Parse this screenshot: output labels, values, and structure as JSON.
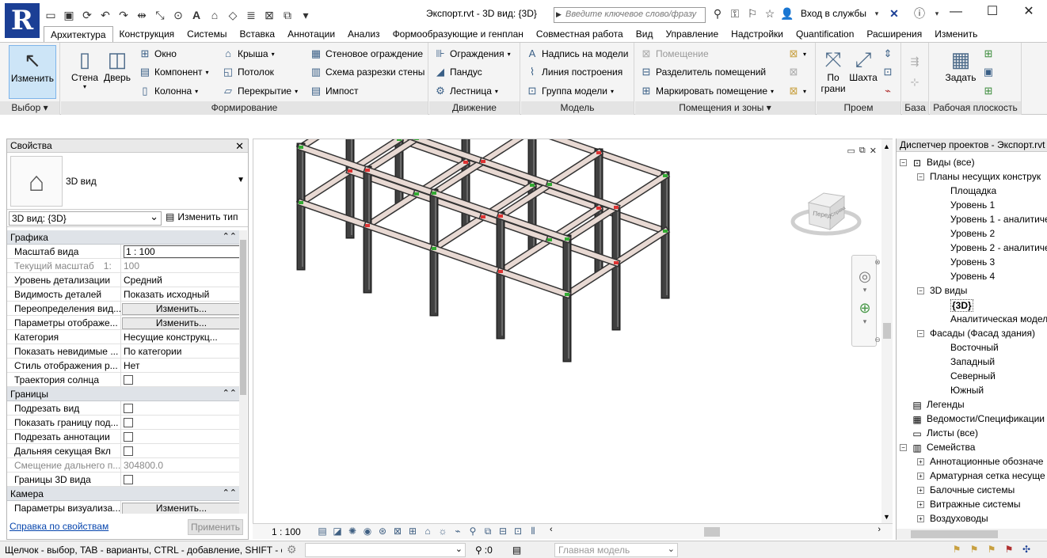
{
  "app": {
    "logo_letter": "R",
    "document_title": "Экспорт.rvt - 3D вид: {3D}",
    "search_placeholder": "Введите ключевое слово/фразу",
    "signin_label": "Вход в службы",
    "window_controls": [
      "—",
      "☐",
      "✕"
    ],
    "qat_icons": [
      "open-icon",
      "save-icon",
      "sync-icon",
      "undo-icon",
      "redo-icon",
      "measure-icon",
      "dimension-icon",
      "tag-icon",
      "text-icon",
      "3d-view-icon",
      "section-icon",
      "thin-lines-icon",
      "close-windows-icon",
      "switch-windows-icon",
      "customize-icon"
    ]
  },
  "ribbon_tabs": [
    {
      "label": "Архитектура",
      "active": true
    },
    {
      "label": "Конструкция"
    },
    {
      "label": "Системы"
    },
    {
      "label": "Вставка"
    },
    {
      "label": "Аннотации"
    },
    {
      "label": "Анализ"
    },
    {
      "label": "Формообразующие и генплан"
    },
    {
      "label": "Совместная работа"
    },
    {
      "label": "Вид"
    },
    {
      "label": "Управление"
    },
    {
      "label": "Надстройки"
    },
    {
      "label": "Quantification"
    },
    {
      "label": "Расширения"
    },
    {
      "label": "Изменить"
    }
  ],
  "ribbon": {
    "select": {
      "modify": "Изменить",
      "label": "Выбор ▾"
    },
    "build": {
      "wall": "Стена",
      "door": "Дверь",
      "window": "Окно",
      "component": "Компонент",
      "column": "Колонна",
      "roof": "Крыша",
      "ceiling": "Потолок",
      "floor": "Перекрытие",
      "curtain_system": "Стеновое ограждение",
      "curtain_grid": "Схема разрезки стены",
      "mullion": "Импост",
      "label": "Формирование"
    },
    "circulation": {
      "railing": "Ограждения",
      "ramp": "Пандус",
      "stair": "Лестница",
      "label": "Движение"
    },
    "model": {
      "model_text": "Надпись на модели",
      "model_line": "Линия построения",
      "model_group": "Группа модели",
      "label": "Модель"
    },
    "room": {
      "room": "Помещение",
      "room_separator": "Разделитель помещений",
      "tag_room": "Маркировать помещение",
      "label": "Помещения и зоны ▾"
    },
    "opening": {
      "by_face": "По",
      "by_face2": "грани",
      "shaft": "Шахта",
      "label": "Проем"
    },
    "datum": {
      "label": "База"
    },
    "workplane": {
      "set": "Задать",
      "label": "Рабочая плоскость"
    }
  },
  "properties": {
    "title": "Свойства",
    "type_name": "3D вид",
    "instance": "3D вид: {3D}",
    "edit_type": "Изменить тип",
    "groups": [
      {
        "name": "Графика",
        "rows": [
          {
            "name": "Масштаб вида",
            "value": "1 : 100",
            "kind": "scale"
          },
          {
            "name": "Текущий масштаб",
            "value": "100",
            "kind": "ro",
            "name_suffix": "1:"
          },
          {
            "name": "Уровень детализации",
            "value": "Средний"
          },
          {
            "name": "Видимость деталей",
            "value": "Показать исходный"
          },
          {
            "name": "Переопределения вид...",
            "value": "Изменить...",
            "kind": "button"
          },
          {
            "name": "Параметры отображе...",
            "value": "Изменить...",
            "kind": "button"
          },
          {
            "name": "Категория",
            "value": "Несущие конструкц..."
          },
          {
            "name": "Показать невидимые ...",
            "value": "По категории"
          },
          {
            "name": "Стиль отображения р...",
            "value": "Нет"
          },
          {
            "name": "Траектория солнца",
            "value": "",
            "kind": "check"
          }
        ]
      },
      {
        "name": "Границы",
        "rows": [
          {
            "name": "Подрезать вид",
            "value": "",
            "kind": "check"
          },
          {
            "name": "Показать границу под...",
            "value": "",
            "kind": "check"
          },
          {
            "name": "Подрезать аннотации",
            "value": "",
            "kind": "check"
          },
          {
            "name": "Дальняя секущая Вкл",
            "value": "",
            "kind": "check"
          },
          {
            "name": "Смещение дальнего п...",
            "value": "304800.0",
            "kind": "ro"
          },
          {
            "name": "Границы 3D вида",
            "value": "",
            "kind": "check"
          }
        ]
      },
      {
        "name": "Камера",
        "rows": [
          {
            "name": "Параметры визуализа...",
            "value": "Изменить...",
            "kind": "button"
          }
        ]
      }
    ],
    "help_link": "Справка по свойствам",
    "apply": "Применить"
  },
  "viewport": {
    "viewcube_face": "Перед",
    "viewcube_side": "Справа",
    "view_scale": "1 : 100"
  },
  "browser": {
    "title": "Диспетчер проектов - Экспорт.rvt",
    "nodes": [
      {
        "label": "Виды (все)",
        "level": 0,
        "toggle": "−",
        "icon": "views-icon"
      },
      {
        "label": "Планы несущих конструк",
        "level": 1,
        "toggle": "−"
      },
      {
        "label": "Площадка",
        "level": 2
      },
      {
        "label": "Уровень 1",
        "level": 2
      },
      {
        "label": "Уровень 1 - аналитиче",
        "level": 2
      },
      {
        "label": "Уровень 2",
        "level": 2
      },
      {
        "label": "Уровень 2 - аналитиче",
        "level": 2
      },
      {
        "label": "Уровень 3",
        "level": 2
      },
      {
        "label": "Уровень 4",
        "level": 2
      },
      {
        "label": "3D виды",
        "level": 1,
        "toggle": "−"
      },
      {
        "label": "{3D}",
        "level": 2,
        "bold": true
      },
      {
        "label": "Аналитическая модел",
        "level": 2
      },
      {
        "label": "Фасады (Фасад здания)",
        "level": 1,
        "toggle": "−"
      },
      {
        "label": "Восточный",
        "level": 2
      },
      {
        "label": "Западный",
        "level": 2
      },
      {
        "label": "Северный",
        "level": 2
      },
      {
        "label": "Южный",
        "level": 2
      },
      {
        "label": "Легенды",
        "level": 0,
        "icon": "legend-icon"
      },
      {
        "label": "Ведомости/Спецификации",
        "level": 0,
        "icon": "schedule-icon"
      },
      {
        "label": "Листы (все)",
        "level": 0,
        "icon": "sheet-icon"
      },
      {
        "label": "Семейства",
        "level": 0,
        "toggle": "−",
        "icon": "family-icon"
      },
      {
        "label": "Аннотационные обозначе",
        "level": 1,
        "toggle": "+"
      },
      {
        "label": "Арматурная сетка несуще",
        "level": 1,
        "toggle": "+"
      },
      {
        "label": "Балочные системы",
        "level": 1,
        "toggle": "+"
      },
      {
        "label": "Витражные системы",
        "level": 1,
        "toggle": "+"
      },
      {
        "label": "Воздуховоды",
        "level": 1,
        "toggle": "+"
      }
    ]
  },
  "status": {
    "hint": "Щелчок - выбор, TAB - варианты, CTRL - добавление, SHIFT - с",
    "filter_count": ":0",
    "model": "Главная модель"
  },
  "colors": {
    "accent": "#1b3f95",
    "selection": "#cde5f7",
    "beam": "#e8d9d3",
    "column": "#404040"
  }
}
